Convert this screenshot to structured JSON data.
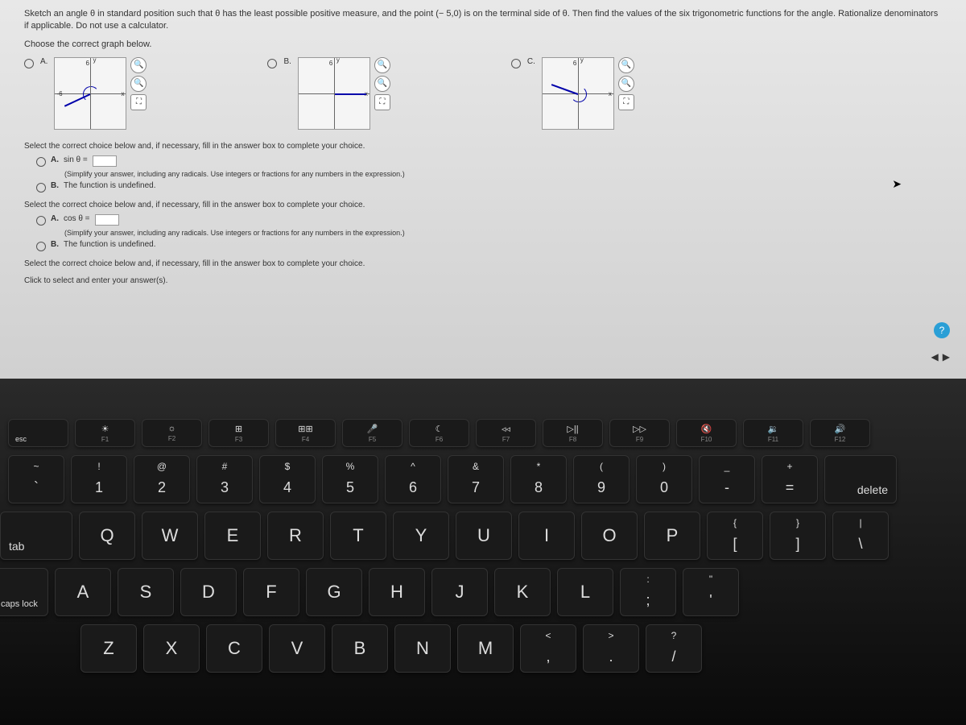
{
  "question": {
    "prompt": "Sketch an angle θ in standard position such that θ has the least possible positive measure, and the point (− 5,0) is on the terminal side of θ. Then find the values of the six trigonometric functions for the angle. Rationalize denominators if applicable. Do not use a calculator.",
    "choose_graph": "Choose the correct graph below.",
    "options": {
      "a": "A.",
      "b": "B.",
      "c": "C."
    },
    "axis": {
      "y": "y",
      "x": "x",
      "six": "6",
      "neg_six": "-6"
    }
  },
  "sections": {
    "select_prompt": "Select the correct choice below and, if necessary, fill in the answer box to complete your choice.",
    "sin": {
      "a_label": "A.",
      "a_text": "sin θ =",
      "hint": "(Simplify your answer, including any radicals. Use integers or fractions for any numbers in the expression.)",
      "b_label": "B.",
      "b_text": "The function is undefined."
    },
    "cos": {
      "a_label": "A.",
      "a_text": "cos θ =",
      "hint": "(Simplify your answer, including any radicals. Use integers or fractions for any numbers in the expression.)",
      "b_label": "B.",
      "b_text": "The function is undefined."
    },
    "footer": "Click to select and enter your answer(s)."
  },
  "help": "?",
  "nav": {
    "prev": "◀",
    "next": "▶"
  },
  "keyboard": {
    "fn_row": [
      {
        "icon": "",
        "label": "esc"
      },
      {
        "icon": "☀",
        "label": "F1"
      },
      {
        "icon": "☼",
        "label": "F2"
      },
      {
        "icon": "⊞",
        "label": "F3"
      },
      {
        "icon": "⊞⊞",
        "label": "F4"
      },
      {
        "icon": "🎤",
        "label": "F5"
      },
      {
        "icon": "☾",
        "label": "F6"
      },
      {
        "icon": "◃◃",
        "label": "F7"
      },
      {
        "icon": "▷||",
        "label": "F8"
      },
      {
        "icon": "▷▷",
        "label": "F9"
      },
      {
        "icon": "🔇",
        "label": "F10"
      },
      {
        "icon": "🔉",
        "label": "F11"
      },
      {
        "icon": "🔊",
        "label": "F12"
      }
    ],
    "num_row": [
      {
        "u": "~",
        "l": "`"
      },
      {
        "u": "!",
        "l": "1"
      },
      {
        "u": "@",
        "l": "2"
      },
      {
        "u": "#",
        "l": "3"
      },
      {
        "u": "$",
        "l": "4"
      },
      {
        "u": "%",
        "l": "5"
      },
      {
        "u": "^",
        "l": "6"
      },
      {
        "u": "&",
        "l": "7"
      },
      {
        "u": "*",
        "l": "8"
      },
      {
        "u": "(",
        "l": "9"
      },
      {
        "u": ")",
        "l": "0"
      },
      {
        "u": "_",
        "l": "-"
      },
      {
        "u": "+",
        "l": "="
      }
    ],
    "delete": "delete",
    "tab": "tab",
    "qwerty_row": [
      "Q",
      "W",
      "E",
      "R",
      "T",
      "Y",
      "U",
      "I",
      "O",
      "P"
    ],
    "bracket_keys": [
      {
        "u": "{",
        "l": "["
      },
      {
        "u": "}",
        "l": "]"
      },
      {
        "u": "|",
        "l": "\\"
      }
    ],
    "caps": "caps lock",
    "asdf_row": [
      "A",
      "S",
      "D",
      "F",
      "G",
      "H",
      "J",
      "K",
      "L"
    ],
    "semi_keys": [
      {
        "u": ":",
        "l": ";"
      },
      {
        "u": "\"",
        "l": "'"
      }
    ],
    "zxcv_row": [
      "Z",
      "X",
      "C",
      "V",
      "B",
      "N",
      "M"
    ],
    "comma_keys": [
      {
        "u": "<",
        "l": ","
      },
      {
        "u": ">",
        "l": "."
      },
      {
        "u": "?",
        "l": "/"
      }
    ]
  }
}
